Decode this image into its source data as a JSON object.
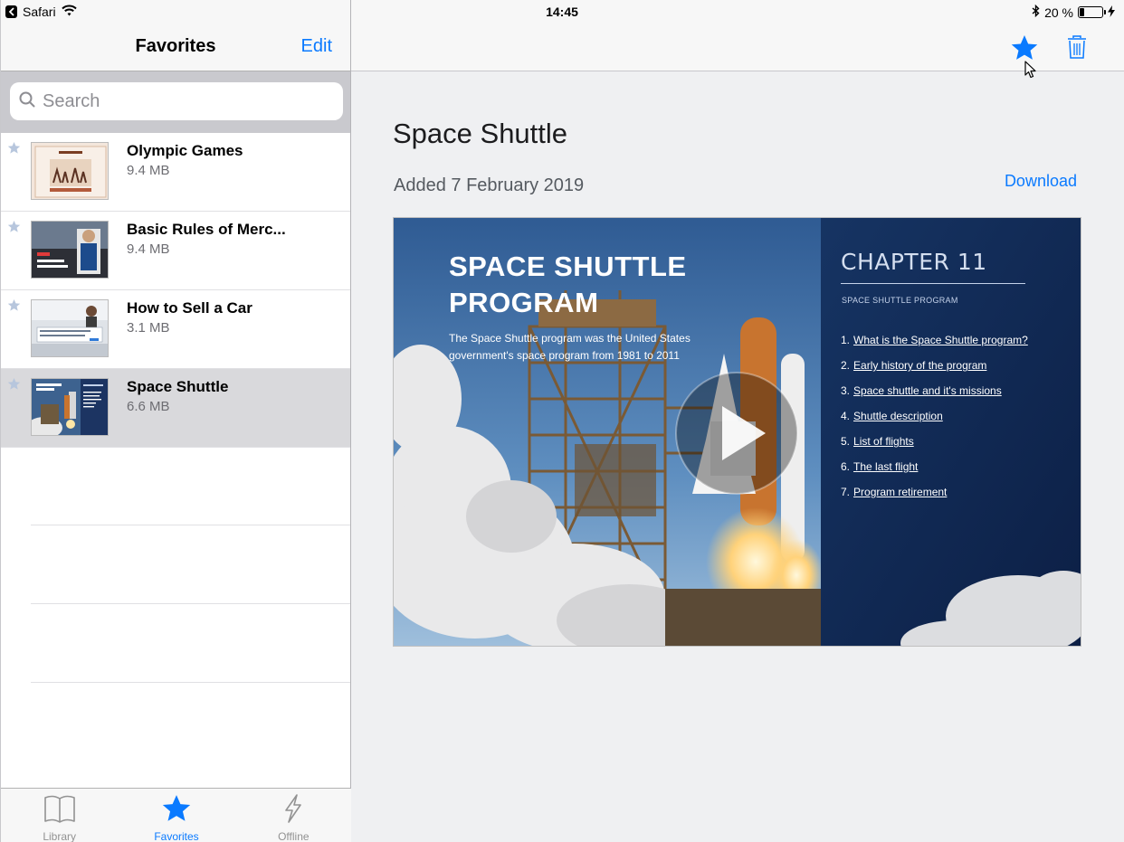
{
  "status_bar": {
    "app": "Safari",
    "time": "14:45",
    "battery": "20 %",
    "battery_level": 0.2
  },
  "sidebar": {
    "title": "Favorites",
    "edit_label": "Edit",
    "search_placeholder": "Search",
    "items": [
      {
        "title": "Olympic Games",
        "size": "9.4 MB",
        "thumb": "olympic-thumb"
      },
      {
        "title": "Basic Rules of Merc...",
        "size": "9.4 MB",
        "thumb": "merch-thumb"
      },
      {
        "title": "How to Sell a Car",
        "size": "3.1 MB",
        "thumb": "car-thumb"
      },
      {
        "title": "Space Shuttle",
        "size": "6.6 MB",
        "thumb": "shuttle-thumb",
        "selected": true
      }
    ]
  },
  "tabbar": {
    "tabs": [
      {
        "label": "Library",
        "icon": "book-icon"
      },
      {
        "label": "Favorites",
        "icon": "star-icon",
        "active": true
      },
      {
        "label": "Offline",
        "icon": "bolt-icon"
      }
    ]
  },
  "main": {
    "title": "Space Shuttle",
    "added": "Added 7 February 2019",
    "download_label": "Download",
    "slide": {
      "title_line1": "SPACE SHUTTLE",
      "title_line2": "PROGRAM",
      "description": "The Space Shuttle program was the United States government's space program from 1981 to 2011",
      "chapter": "CHAPTER 11",
      "chapter_subtitle": "SPACE SHUTTLE PROGRAM",
      "toc": [
        {
          "num": "1.",
          "text": "What is the Space Shuttle program?"
        },
        {
          "num": "2.",
          "text": "Early history of the program"
        },
        {
          "num": "3.",
          "text": "Space shuttle and it's missions"
        },
        {
          "num": "4.",
          "text": "Shuttle description"
        },
        {
          "num": "5.",
          "text": "List of flights"
        },
        {
          "num": "6.",
          "text": "The last flight"
        },
        {
          "num": "7.",
          "text": "Program retirement"
        }
      ]
    }
  },
  "colors": {
    "accent": "#0a7aff",
    "sidebar_fav_star": "#b7c6dd",
    "selected_row": "#d9d9dc",
    "main_bg": "#eff0f2"
  }
}
